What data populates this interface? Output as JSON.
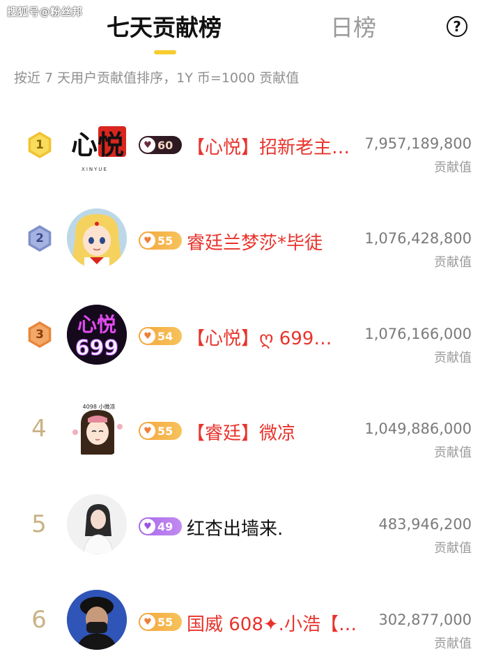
{
  "watermark": "搜狐号@粉丝邦",
  "tabs": {
    "active": "七天贡献榜",
    "inactive": "日榜",
    "help": "?"
  },
  "subtitle": "按近 7 天用户贡献值排序，1Y 币=1000 贡献值",
  "colors": {
    "accent": "#f7cc2f",
    "name_red": "#e8332b",
    "name_dark": "#111111"
  },
  "rows": [
    {
      "rank": "1",
      "rank_style": "gold",
      "level": "60",
      "badge_style": "dark",
      "name": "【心悦】招新老主…",
      "name_color": "red",
      "score": "7,957,189,800",
      "score_label": "贡献值",
      "avatar": "xinyue-logo"
    },
    {
      "rank": "2",
      "rank_style": "silver",
      "level": "55",
      "badge_style": "orange",
      "name": "睿廷兰梦莎*毕徒",
      "name_color": "red",
      "score": "1,076,428,800",
      "score_label": "贡献值",
      "avatar": "anime-girl"
    },
    {
      "rank": "3",
      "rank_style": "bronze",
      "level": "54",
      "badge_style": "orange",
      "name": "【心悦】ღ 699…",
      "name_color": "red",
      "score": "1,076,166,000",
      "score_label": "贡献值",
      "avatar": "xinyue-699"
    },
    {
      "rank": "4",
      "rank_style": "plain",
      "level": "55",
      "badge_style": "orange",
      "name": "【睿廷】微凉",
      "name_color": "red",
      "score": "1,049,886,000",
      "score_label": "贡献值",
      "avatar": "cartoon-girl"
    },
    {
      "rank": "5",
      "rank_style": "plain",
      "level": "49",
      "badge_style": "purple",
      "name": "红杏出墙来.",
      "name_color": "dark",
      "score": "483,946,200",
      "score_label": "贡献值",
      "avatar": "woman-photo"
    },
    {
      "rank": "6",
      "rank_style": "plain",
      "level": "55",
      "badge_style": "orange",
      "name": "国威 608✦.小浩【…",
      "name_color": "red",
      "score": "302,877,000",
      "score_label": "贡献值",
      "avatar": "man-masked"
    }
  ],
  "avatar_text": {
    "xinyue_logo": "心悦",
    "xinyue_logo_sub": "XINYUE",
    "xinyue_699_top": "心悦",
    "xinyue_699_bottom": "699",
    "cartoon_caption": "4098 小微凉"
  }
}
